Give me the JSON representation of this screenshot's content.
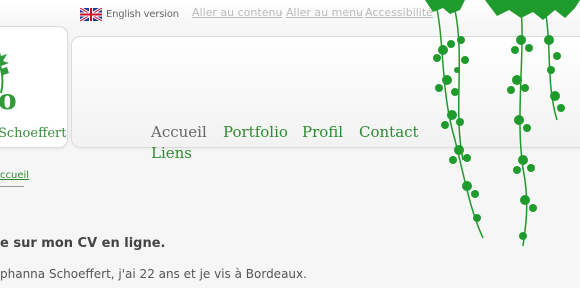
{
  "topbar": {
    "language_label": "English version",
    "skip_links": [
      {
        "label": "Aller au contenu"
      },
      {
        "label": "Aller au menu"
      },
      {
        "label": "Accessibilité"
      }
    ],
    "separator": "-"
  },
  "logo": {
    "letter": "o",
    "name": "Schoeffert"
  },
  "nav": {
    "items": [
      {
        "label": "Accueil",
        "current": true
      },
      {
        "label": "Portfolio"
      },
      {
        "label": "Profil"
      },
      {
        "label": "Contact"
      },
      {
        "label": "Liens"
      }
    ]
  },
  "breadcrumb": {
    "label": "ccueil"
  },
  "content": {
    "heading": "e sur mon CV en ligne.",
    "intro": "phanna Schoeffert, j'ai 22 ans et je vis à Bordeaux."
  },
  "colors": {
    "accent": "#2e8b2f",
    "vine": "#1f9a2c",
    "text": "#444444"
  }
}
